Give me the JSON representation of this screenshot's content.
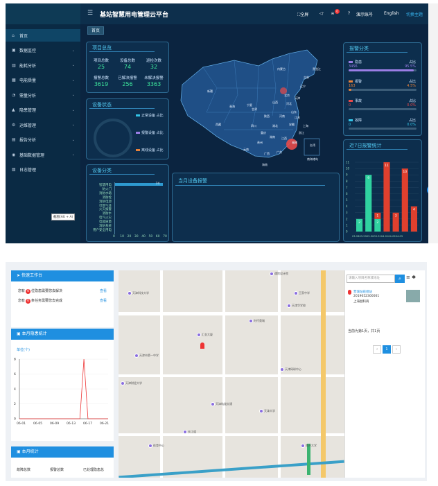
{
  "header": {
    "title": "基站智慧用电管理云平台",
    "fullscreen": "全屏",
    "bell_count": "0",
    "account": "演示账号",
    "lang": "English",
    "theme": "切换主题"
  },
  "breadcrumb": "首页",
  "sidebar": {
    "items": [
      {
        "icon": "home-icon",
        "label": "首页"
      },
      {
        "icon": "monitor-icon",
        "label": "数据监控"
      },
      {
        "icon": "chart-icon",
        "label": "能耗分析"
      },
      {
        "icon": "grid-icon",
        "label": "电能质量"
      },
      {
        "icon": "pie-icon",
        "label": "需量分析"
      },
      {
        "icon": "warning-icon",
        "label": "隐患管理"
      },
      {
        "icon": "gear-icon",
        "label": "运维管理"
      },
      {
        "icon": "report-icon",
        "label": "报告分析"
      },
      {
        "icon": "database-icon",
        "label": "基础数据管理"
      },
      {
        "icon": "log-icon",
        "label": "日志管理"
      }
    ],
    "tooltip": "截图(Alt + A)"
  },
  "overview": {
    "title": "项目总览",
    "stats": [
      {
        "k": "项目总数",
        "v": "25"
      },
      {
        "k": "设备总数",
        "v": "74"
      },
      {
        "k": "巡检次数",
        "v": "32"
      },
      {
        "k": "报警总数",
        "v": "3619"
      },
      {
        "k": "已解决报警",
        "v": "256"
      },
      {
        "k": "未解决报警",
        "v": "3363"
      }
    ]
  },
  "device_status": {
    "title": "设备状态",
    "legend": [
      {
        "label": "正常设备 占比",
        "color": "#33c5e8"
      },
      {
        "label": "报警设备 占比",
        "color": "#9b7ee6"
      },
      {
        "label": "离线设备 占比",
        "color": "#e8823a"
      }
    ]
  },
  "device_class": {
    "title": "设备分类",
    "cats": [
      "智慧用电",
      "防火门",
      "消防水箱",
      "消防栓",
      "消防电源",
      "可燃气体",
      "火灾报警",
      "消防水",
      "电气火灾",
      "电能质量",
      "消防系统",
      "用户安全用电"
    ],
    "value": 74,
    "first_label": "74",
    "ticks": [
      "0",
      "10",
      "20",
      "30",
      "40",
      "50",
      "60",
      "70"
    ]
  },
  "current_alarm": {
    "title": "当月设备报警"
  },
  "map": {
    "labels": [
      "黑龙江",
      "吉林",
      "内蒙古",
      "辽宁",
      "北京",
      "天津",
      "新疆",
      "宁夏",
      "山西",
      "河北",
      "山东",
      "青海",
      "甘肃",
      "陕西",
      "河南",
      "江苏",
      "安徽",
      "上海",
      "西藏",
      "四川",
      "湖北",
      "重庆",
      "浙江",
      "湖南",
      "江西",
      "贵州",
      "福建",
      "云南",
      "广西",
      "广东",
      "台湾",
      "海南",
      "南海诸岛"
    ]
  },
  "alarm_class": {
    "title": "报警分类",
    "rows": [
      {
        "name": "隐患",
        "ratio_label": "占比",
        "count": "3456",
        "pct": "95.5%",
        "fill": 0.955,
        "color": "#9b7ee6"
      },
      {
        "name": "报警",
        "ratio_label": "占比",
        "count": "163",
        "pct": "4.5%",
        "fill": 0.045,
        "color": "#e8823a"
      },
      {
        "name": "事故",
        "ratio_label": "占比",
        "count": "0",
        "pct": "0.0%",
        "fill": 0,
        "color": "#e84a4a"
      },
      {
        "name": "故障",
        "ratio_label": "占比",
        "count": "0",
        "pct": "0.0%",
        "fill": 0,
        "color": "#33c5e8"
      }
    ]
  },
  "chart_data": [
    {
      "type": "bar",
      "title": "近7日报警统计",
      "categories": [
        "03-28",
        "03-29",
        "03-30",
        "03-31",
        "04-01",
        "04-02",
        "04-03"
      ],
      "series": [
        {
          "color": "#2fd2a0",
          "values": [
            2,
            9,
            2,
            0,
            0,
            0,
            0
          ]
        },
        {
          "color": "#e0402e",
          "values": [
            0,
            0,
            1,
            11,
            3,
            10,
            4
          ]
        }
      ],
      "ylim": [
        0,
        11
      ],
      "yticks": [
        "0",
        "1",
        "2",
        "3",
        "4",
        "5",
        "6",
        "7",
        "8",
        "9",
        "10",
        "11"
      ],
      "xtick_text": "03-2803-2903-3003-3104-0104-0204-03"
    },
    {
      "type": "line",
      "title": "本月隐患统计",
      "ylabel": "单位(个)",
      "x": [
        "06-01",
        "06-05",
        "06-09",
        "06-13",
        "06-17",
        "06-21"
      ],
      "points": [
        [
          1,
          0
        ],
        [
          16,
          0
        ],
        [
          17,
          8
        ],
        [
          18,
          0
        ],
        [
          23,
          0
        ]
      ],
      "ylim": [
        0,
        8
      ],
      "yticks": [
        "0",
        "2",
        "4",
        "6",
        "8"
      ]
    }
  ],
  "workbench": {
    "title": "快速工作台",
    "items": [
      {
        "pre": "您有",
        "count": "0",
        "post": "位隐患需要您去解决",
        "action": "查看"
      },
      {
        "pre": "您有",
        "count": "0",
        "post": "条任务需要您去完成",
        "action": "查看"
      }
    ]
  },
  "hazard": {
    "title": "本月隐患统计"
  },
  "month_stats": {
    "title": "本月统计",
    "cols": [
      "故障总数",
      "报警总数",
      "已处理隐患总"
    ]
  },
  "map2": {
    "labels": [
      "遭院设计院",
      "王家中学",
      "天津华学校",
      "天津市第一中学",
      "天津财经大学",
      "汇金大厦",
      "时代奥城",
      "天津网球中心",
      "天津轨道交通",
      "天津大学",
      "体育中心",
      "长江道",
      "天津科技大学",
      "南开大学"
    ]
  },
  "search": {
    "placeholder": "请输入项目名称或地址",
    "result_title": "营城站班组站",
    "result_line1": "2019052300001",
    "result_line2": "上海副科商",
    "page_info": "当前为第1页，共1页",
    "page": "1"
  }
}
